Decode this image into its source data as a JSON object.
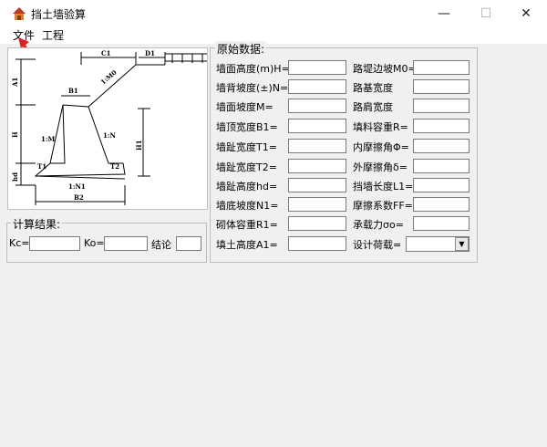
{
  "window": {
    "title": "挡土墙验算",
    "minimize": "—",
    "maximize": "☐",
    "close": "✕"
  },
  "menu": {
    "items": [
      "文件",
      "工程"
    ]
  },
  "diagram": {
    "labels": {
      "c1": "C1",
      "d1": "D1",
      "b1": "B1",
      "m0": "1:M0",
      "a1": "A1",
      "h": "H",
      "m": "1:M",
      "n": "1:N",
      "h1": "H1",
      "t1": "T1",
      "t2": "T2",
      "hd": "hd",
      "n1": "1:N1",
      "b2": "B2"
    }
  },
  "original": {
    "title": "原始数据:",
    "left": [
      {
        "label": "墙面高度(m)H=",
        "value": ""
      },
      {
        "label": "墙背坡度(±)N=",
        "value": ""
      },
      {
        "label": "墙面坡度M=",
        "value": ""
      },
      {
        "label": "墙顶宽度B1=",
        "value": ""
      },
      {
        "label": "墙趾宽度T1=",
        "value": ""
      },
      {
        "label": "墙趾宽度T2=",
        "value": ""
      },
      {
        "label": "墙趾高度hd=",
        "value": ""
      },
      {
        "label": "墙底坡度N1=",
        "value": ""
      },
      {
        "label": "砌体容重R1=",
        "value": ""
      },
      {
        "label": "填土高度A1=",
        "value": ""
      }
    ],
    "right": [
      {
        "label": "路堤边坡M0=",
        "value": ""
      },
      {
        "label": "路基宽度",
        "value": ""
      },
      {
        "label": "路肩宽度",
        "value": ""
      },
      {
        "label": "填料容重R=",
        "value": ""
      },
      {
        "label": "内摩擦角Φ=",
        "value": ""
      },
      {
        "label": "外摩擦角δ=",
        "value": ""
      },
      {
        "label": "挡墙长度L1=",
        "value": ""
      },
      {
        "label": "摩擦系数FF=",
        "value": ""
      },
      {
        "label": "承载力σo=",
        "value": ""
      },
      {
        "label": "设计荷载=",
        "value": ""
      }
    ]
  },
  "results": {
    "title": "计算结果:",
    "kc_label": "Kc=",
    "kc_value": "",
    "ko_label": "Ko=",
    "ko_value": "",
    "conclusion_label": "结论",
    "conclusion_value": ""
  }
}
